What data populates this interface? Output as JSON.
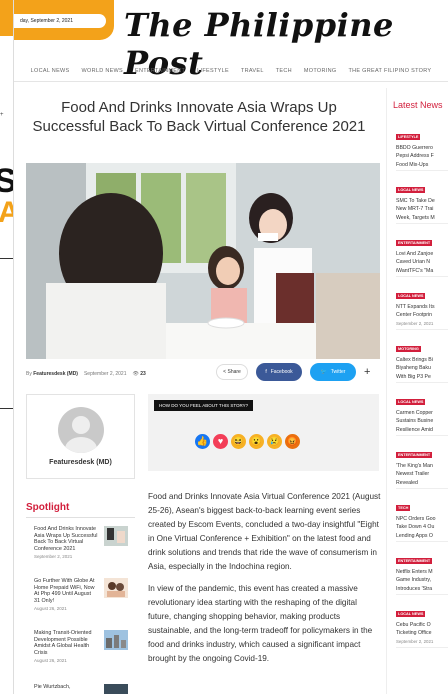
{
  "site": {
    "date": "day, September 2, 2021",
    "masthead": "The Philippine Post"
  },
  "nav": [
    "LOCAL NEWS",
    "WORLD NEWS",
    "ENTERTAINMENT",
    "LIFESTYLE",
    "TRAVEL",
    "TECH",
    "MOTORING",
    "THE GREAT FILIPINO STORY"
  ],
  "article": {
    "title": "Food And Drinks Innovate Asia Wraps Up Successful Back To Back Virtual Conference 2021",
    "author_prefix": "By",
    "author": "Featuresdesk (MD)",
    "date": "September 2, 2021",
    "views": "23",
    "share_label": "Share",
    "facebook_label": "Facebook",
    "twitter_label": "Twitter",
    "body": [
      "Food and Drinks Innovate Asia Virtual Conference 2021 (August 25-26), Asean's biggest back-to-back learning event series created by Escom Events, concluded a two-day insightful \"Eight in One Virtual Conference + Exhibition\" on the latest food and drink solutions and trends that ride the wave of consumerism in Asia, especially in the Indochina region.",
      "In view of the pandemic, this event has created a massive revolutionary idea starting with the reshaping of the digital future, changing shopping behavior, making products sustainable, and the long-term tradeoff for policymakers in the food and drinks industry, which caused a significant impact brought by the ongoing Covid-19."
    ]
  },
  "author_box": {
    "name": "Featuresdesk (MD)"
  },
  "feel_box": {
    "question": "HOW DO YOU FEEL ABOUT THIS STORY?",
    "reactions": [
      "like",
      "love",
      "haha",
      "wow",
      "sad",
      "angry"
    ]
  },
  "spotlight": {
    "title": "Spotlight",
    "items": [
      {
        "title": "Food And Drinks Innovate Asia Wraps Up Successful Back To Back Virtual Conference 2021",
        "date": "September 2, 2021"
      },
      {
        "title": "Go Further With Globe At Home Prepaid WiFi, Now At Php 499 Until August 31 Only!",
        "date": "August 26, 2021"
      },
      {
        "title": "Making Transit-Oriented Development Possible Amidst A Global Health Crisis",
        "date": "August 26, 2021"
      },
      {
        "title": "Pie Wurtzbach,",
        "date": ""
      }
    ]
  },
  "latest": {
    "title": "Latest News",
    "items": [
      {
        "badge": "LIFESTYLE",
        "title": [
          "BBDO Guerrero",
          "Pepsi Address F",
          "Food Mix-Ups"
        ],
        "date": "September 2, 2021"
      },
      {
        "badge": "LOCAL NEWS",
        "title": [
          "SMC To Take De",
          "New MRT-7 Trai",
          "Week, Targets M",
          "Completion Nex"
        ],
        "date": "September 2, 2021"
      },
      {
        "badge": "ENTERTAINMENT",
        "title": [
          "Lovi And Zanjoe",
          "Caved Urian N",
          "iWantTFC's \"Ma"
        ],
        "date": "September 2, 2021"
      },
      {
        "badge": "LOCAL NEWS",
        "title": [
          "NTT Expands Its",
          "Center Footprin"
        ],
        "date": "September 2, 2021"
      },
      {
        "badge": "MOTORING",
        "title": [
          "Caltex Brings Bi",
          "Biyaheng Baku",
          "With Big P3 Pe",
          "Fuel Discount"
        ],
        "date": "September 2, 2021"
      },
      {
        "badge": "LOCAL NEWS",
        "title": [
          "Carmen Copper",
          "Sustains Busine",
          "Resilience Amid",
          "Pandemic"
        ],
        "date": "September 2, 2021"
      },
      {
        "badge": "ENTERTAINMENT",
        "title": [
          "'The King's Man",
          "Newest Trailer",
          "Revealed"
        ],
        "date": "September 2, 2021"
      },
      {
        "badge": "TECH",
        "title": [
          "NPC Orders Goo",
          "Take Down 4 Ou",
          "Lending Apps O",
          "Privacy Risk"
        ],
        "date": "September 2, 2021"
      },
      {
        "badge": "ENTERTAINMENT",
        "title": [
          "Netflix Enters M",
          "Game Industry,",
          "Introduces 'Stra",
          "Things' Games",
          "Android"
        ],
        "date": "September 2, 2021"
      },
      {
        "badge": "LOCAL NEWS",
        "title": [
          "Cebu Pacific O",
          "Ticketing Office"
        ],
        "date": "September 2, 2021"
      }
    ]
  }
}
